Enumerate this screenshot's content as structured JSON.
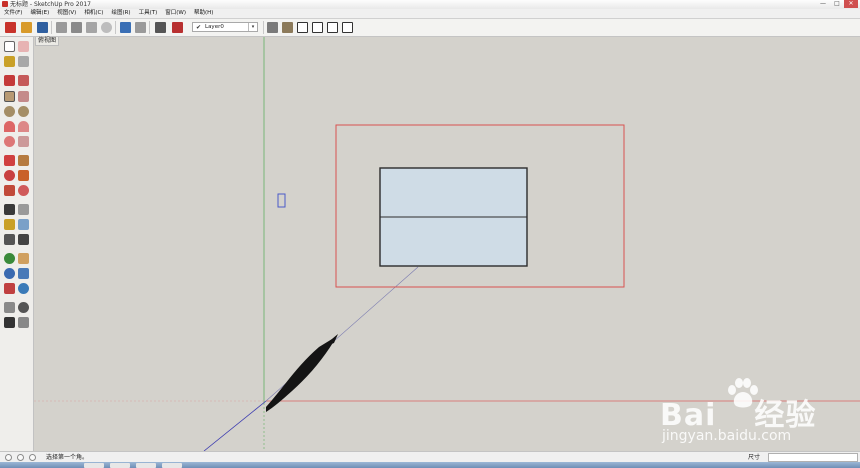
{
  "window": {
    "title": "无标题 - SketchUp Pro 2017",
    "controls": [
      "—",
      "□",
      "✕"
    ]
  },
  "menu": [
    "文件(F)",
    "编辑(E)",
    "视图(V)",
    "相机(C)",
    "绘图(R)",
    "工具(T)",
    "窗口(W)",
    "帮助(H)"
  ],
  "toolbar": {
    "icons": [
      "getting-started-icon",
      "open-icon",
      "save-icon",
      "cut-icon",
      "copy-icon",
      "paste-icon",
      "erase-icon",
      "undo-icon",
      "redo-icon",
      "print-icon",
      "model-info-icon"
    ],
    "layer": {
      "check": "✔",
      "name": "Layer0"
    },
    "view_icons": [
      "iso-view-icon",
      "top-view-icon",
      "front-view-icon",
      "right-view-icon",
      "back-view-icon",
      "left-view-icon"
    ]
  },
  "scene_tab": {
    "label": "俯视图"
  },
  "status": {
    "text": "选择第一个角。",
    "measure_label": "尺寸",
    "measure_value": ""
  },
  "watermark": {
    "brand": "Bai 经验",
    "brand_left": "Bai",
    "brand_right": "经验",
    "url": "jingyan.baidu.com"
  },
  "colors": {
    "accent_red": "#d9534f",
    "axis_green": "#6ab46a",
    "axis_blue": "#3a3ab0",
    "face_fill": "#cfdce6",
    "canvas": "#d4d2cc"
  }
}
